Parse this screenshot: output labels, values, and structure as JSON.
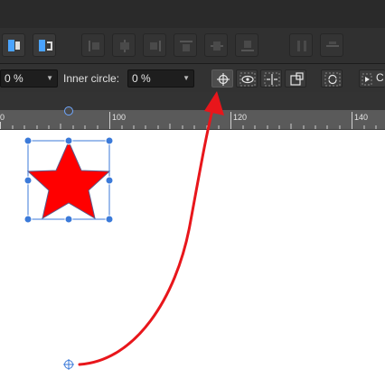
{
  "context_toolbar": {
    "outer_value": "0 %",
    "inner_label": "Inner circle:",
    "inner_value": "0 %",
    "overflow_label": "C"
  },
  "ruler": {
    "ticks": [
      "0",
      "100",
      "120",
      "140"
    ]
  },
  "icons": {
    "transform_origin": "crosshair-target-icon",
    "point_origin": "small-crosshair-icon",
    "snap_visibility": "eye-icon"
  },
  "colors": {
    "star_fill": "#ff0000",
    "selection": "#3b7ad9",
    "annotation_arrow": "#e8161b"
  }
}
